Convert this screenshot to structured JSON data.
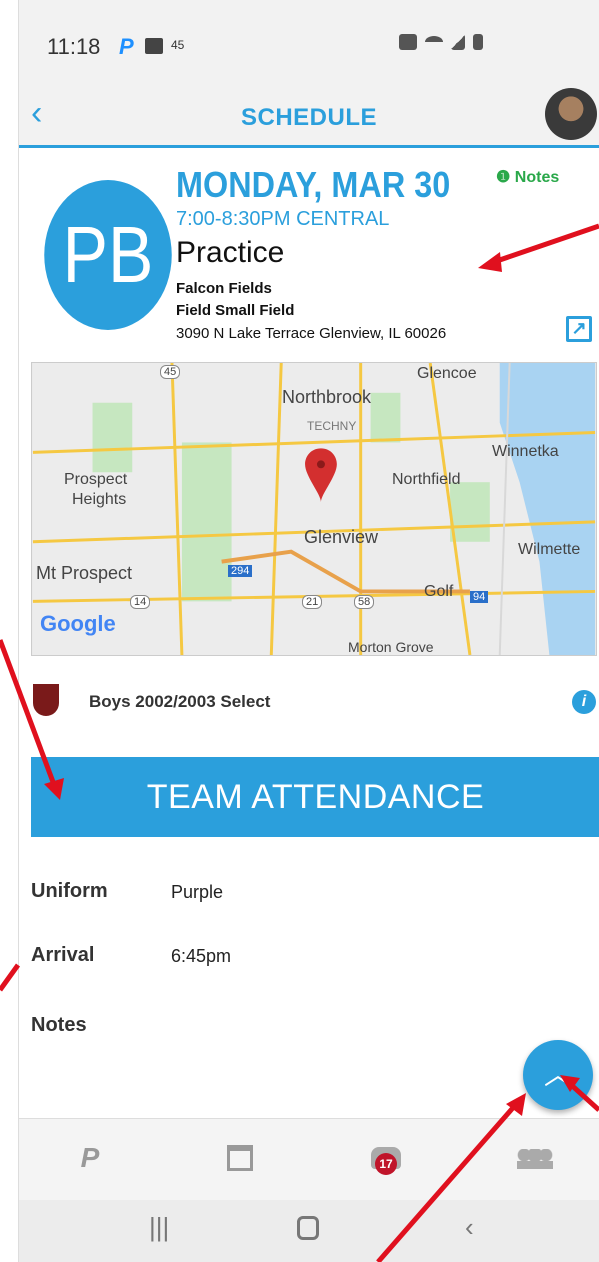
{
  "status_bar": {
    "time": "11:18",
    "temperature": "45"
  },
  "header": {
    "title": "SCHEDULE",
    "back_icon": "chevron-left-icon"
  },
  "event": {
    "avatar_text": "PB",
    "date": "MONDAY, MAR 30",
    "time": "7:00-8:30PM CENTRAL",
    "type": "Practice",
    "venue": "Falcon Fields",
    "field": "Field Small Field",
    "address": "3090 N Lake Terrace Glenview, IL 60026",
    "notes_label": "Notes"
  },
  "map": {
    "labels": [
      "Glencoe",
      "Northbrook",
      "TECHNY",
      "Winnetka",
      "Prospect",
      "Heights",
      "Northfield",
      "Glenview",
      "Wilmette",
      "Mt Prospect",
      "Golf",
      "Morton Grove"
    ],
    "shields": [
      "45",
      "294",
      "21",
      "58",
      "14",
      "94"
    ],
    "logo": "Google"
  },
  "team": {
    "name": "Boys 2002/2003 Select"
  },
  "attendance": {
    "button_label": "TEAM ATTENDANCE"
  },
  "details": [
    {
      "label": "Uniform",
      "value": "Purple"
    },
    {
      "label": "Arrival",
      "value": "6:45pm"
    },
    {
      "label": "Notes",
      "value": ""
    }
  ],
  "tabbar": {
    "badge_count": "17"
  },
  "colors": {
    "accent": "#2b9fdc",
    "notes_green": "#2aa84a",
    "badge": "#c0142a",
    "annotation_arrow": "#e0101e"
  }
}
